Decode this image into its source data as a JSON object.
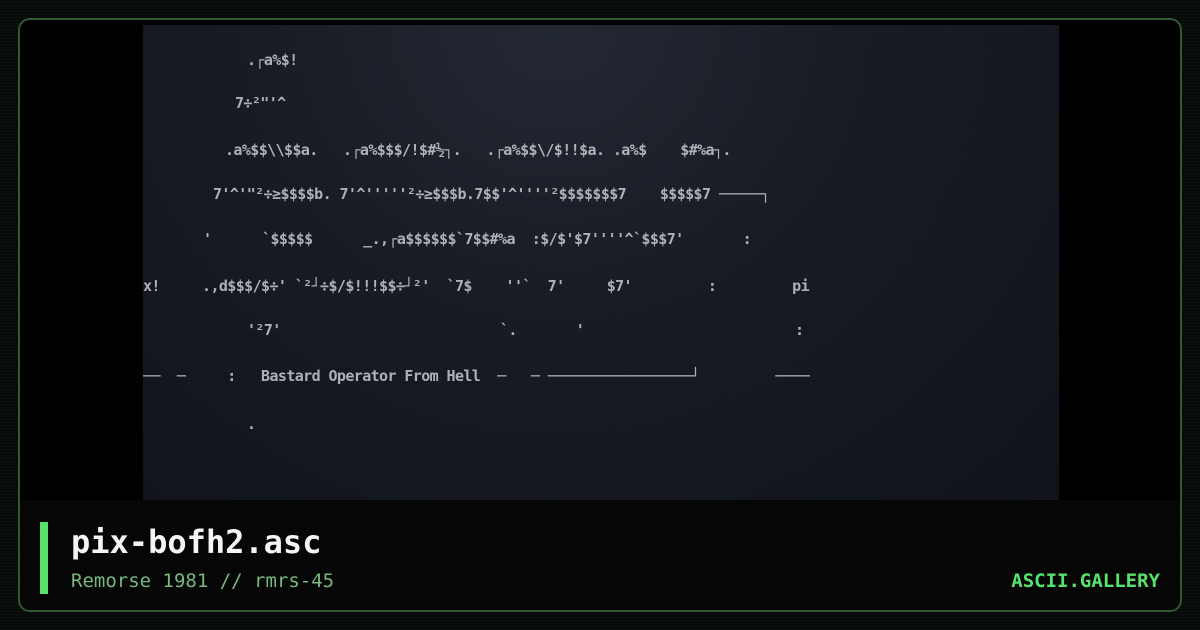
{
  "artwork": {
    "lines": [
      {
        "text": ".┌a%$!",
        "row": 0
      },
      {
        "text": "7÷²\"'^",
        "row": 1
      },
      {
        "text": ".a%$$\\\\$$a.   .┌a%$$$/!$#½┐.   .┌a%$$\\/$!!$a. .a%$    $#%a┐.",
        "row": 2
      },
      {
        "text": "7'^'\"²÷≥$$$$b. 7'^'''''²÷≥$$$b.7$$'^''''²$$$$$$$7    $$$$$7 ─────┐",
        "row": 3
      },
      {
        "text": "'      `$$$$$      _.,┌a$$$$$$`7$$#%a  :$/$'$7''''^`$$$7'       :",
        "row": 4
      },
      {
        "text": "x!     .,d$$$/$÷' `²┘÷$/$!!!$$÷┘²'  `7$    ''`  7'     $7'         :         pi",
        "row": 5
      },
      {
        "text": "'²7'                          `.       '                         :",
        "row": 6
      },
      {
        "text": "──  ─     :   Bastard Operator From Hell  ─   ─ ─────────────────┘         ────",
        "row": 7
      },
      {
        "text": ".",
        "row": 8
      }
    ]
  },
  "footer": {
    "title": "pix-bofh2.asc",
    "subtitle": "Remorse 1981 // rmrs-45",
    "brand": "ASCII.GALLERY"
  },
  "colors": {
    "accent": "#57e36b",
    "border": "#2f5a32",
    "subtitle": "#78b880",
    "art_text": "#c9ccd2"
  }
}
